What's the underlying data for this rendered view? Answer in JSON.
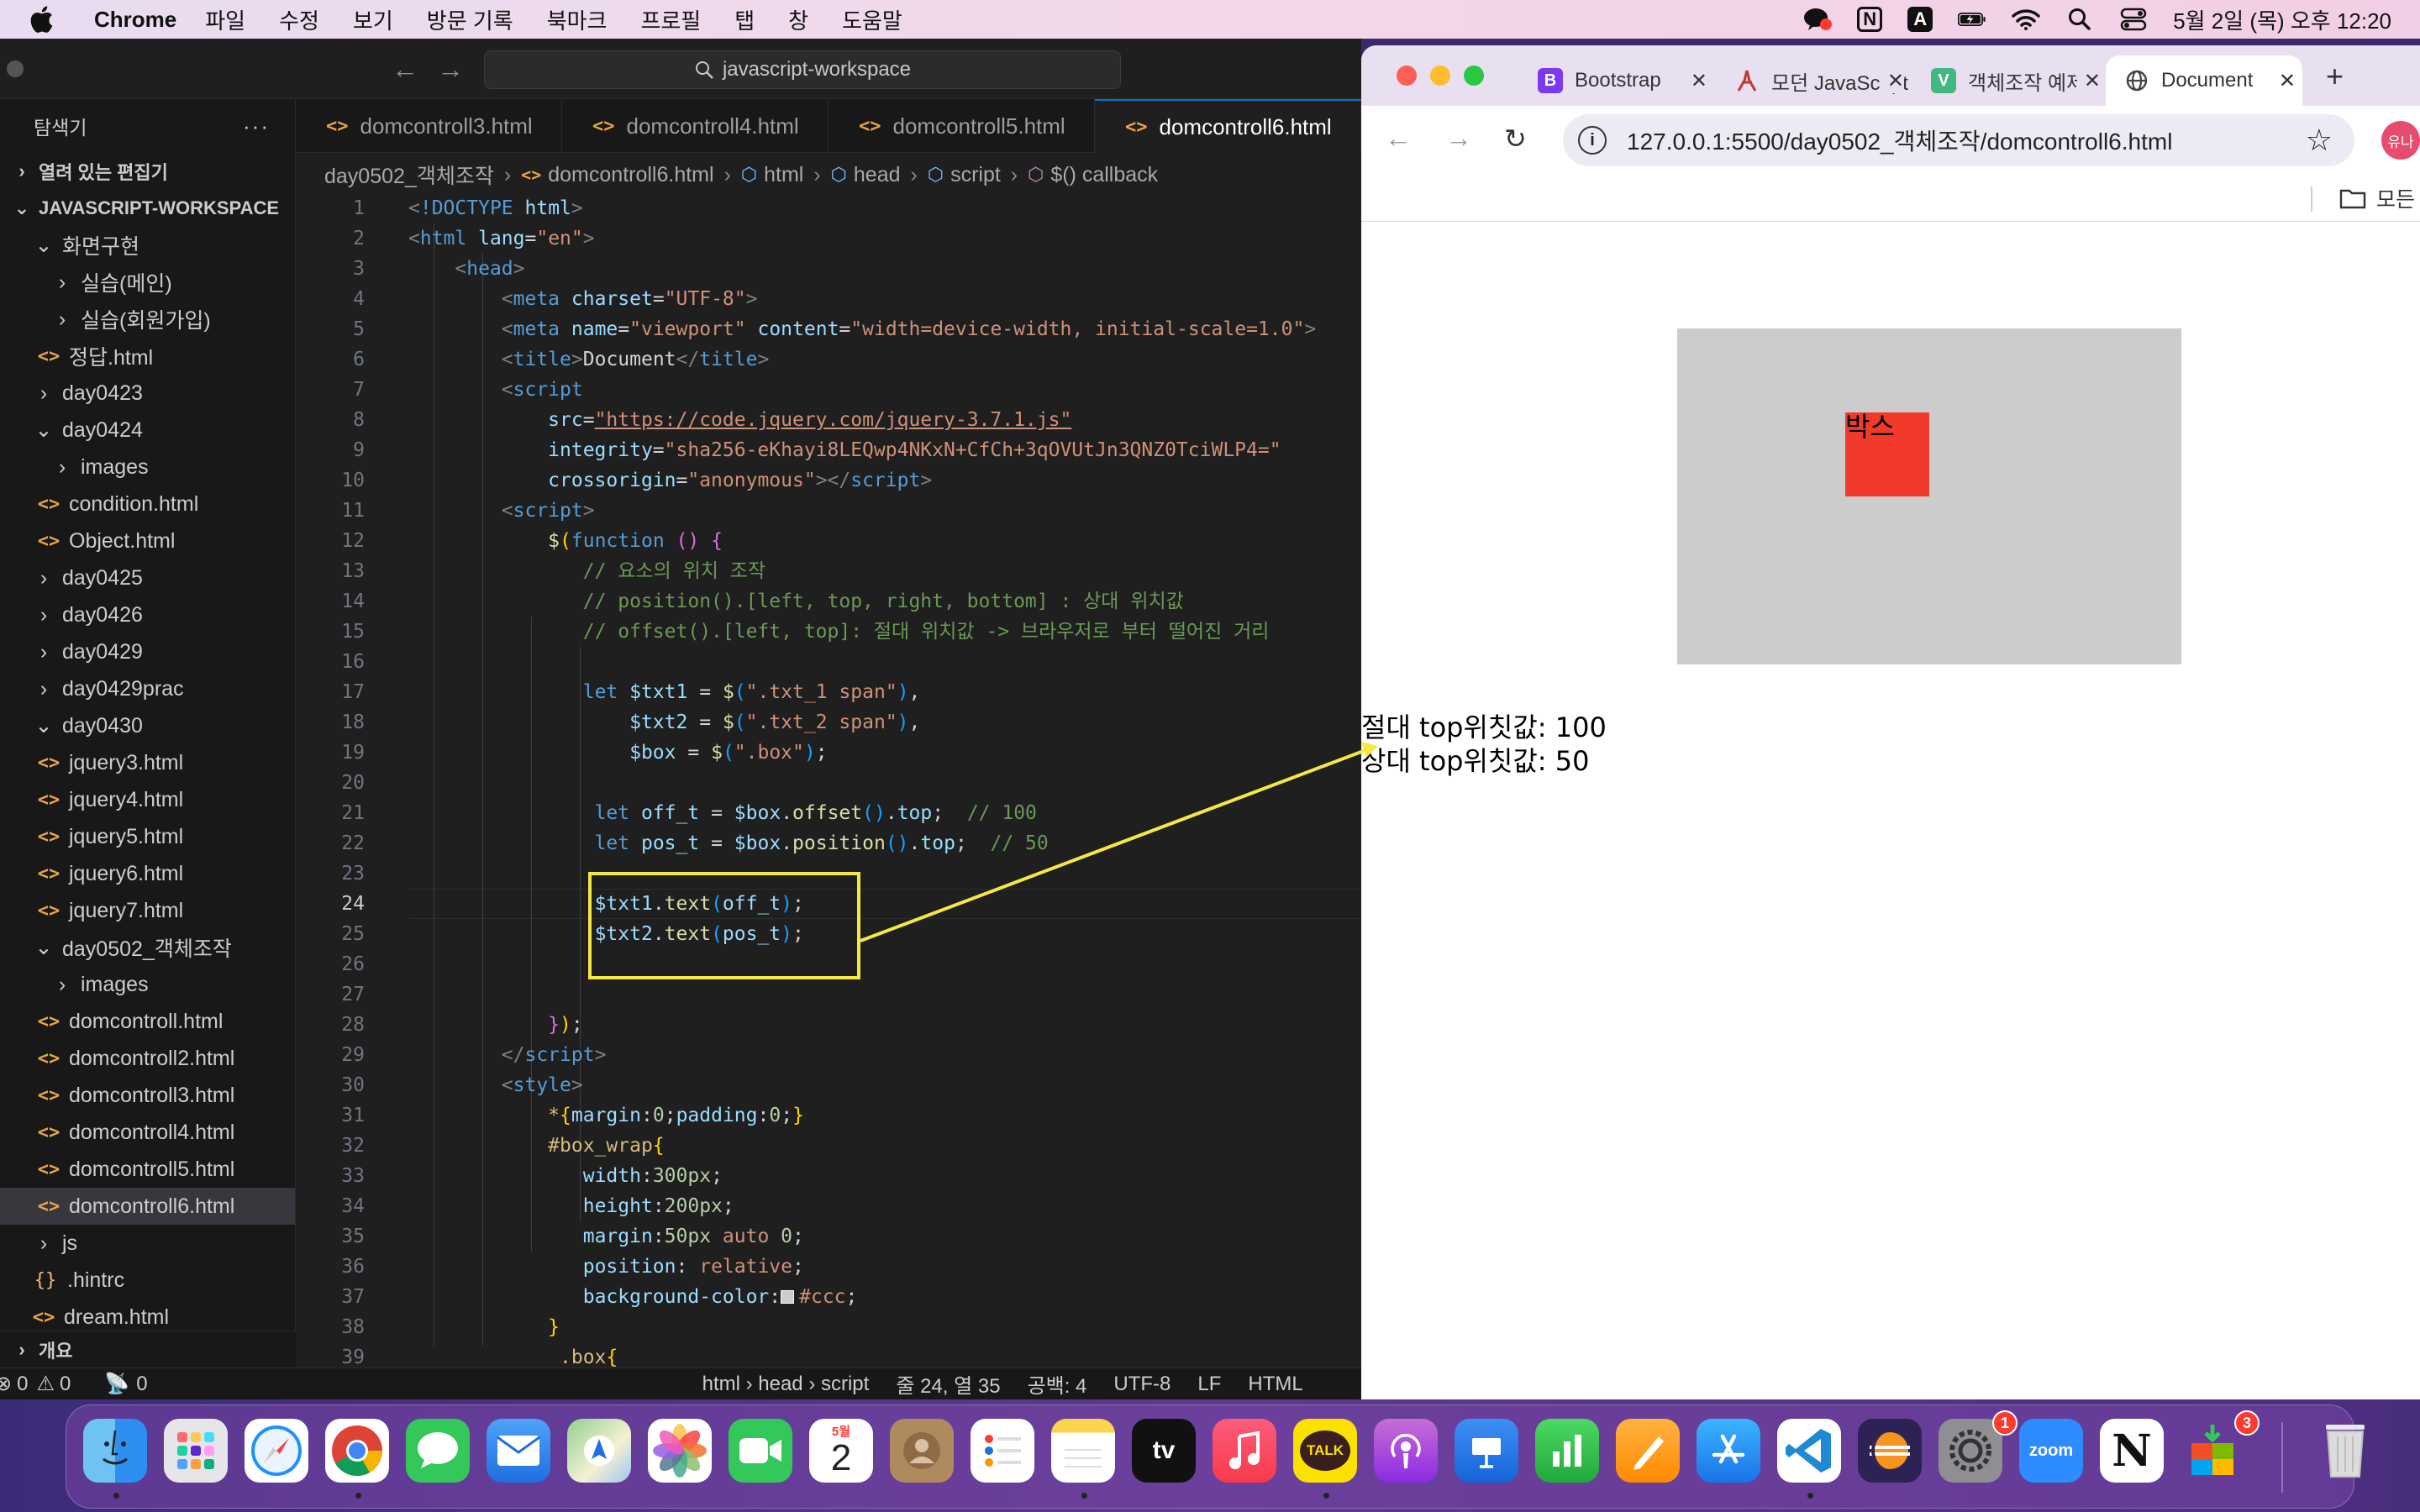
{
  "menubar": {
    "app_name": "Chrome",
    "items": [
      "파일",
      "수정",
      "보기",
      "방문 기록",
      "북마크",
      "프로필",
      "탭",
      "창",
      "도움말"
    ],
    "status_icons": [
      "kakaotalk-icon",
      "notion-icon",
      "input-method-icon",
      "battery-icon",
      "wifi-icon",
      "spotlight-icon",
      "control-center-icon"
    ],
    "notion_letter": "N",
    "input_letter": "A",
    "clock": "5월 2일 (목) 오후 12:20"
  },
  "vscode": {
    "search": "javascript-workspace",
    "explorer_title": "탐색기",
    "explorer_more": "···",
    "open_editors": "열려 있는 편집기",
    "workspace": "JAVASCRIPT-WORKSPACE",
    "tree": [
      {
        "label": "화면구현",
        "kind": "folder-open",
        "depth": 1
      },
      {
        "label": "실습(메인)",
        "kind": "folder",
        "depth": 2
      },
      {
        "label": "실습(회원가입)",
        "kind": "folder",
        "depth": 2
      },
      {
        "label": "정답.html",
        "kind": "html",
        "depth": 2
      },
      {
        "label": "day0423",
        "kind": "folder",
        "depth": 1
      },
      {
        "label": "day0424",
        "kind": "folder-open",
        "depth": 1
      },
      {
        "label": "images",
        "kind": "folder",
        "depth": 2
      },
      {
        "label": "condition.html",
        "kind": "html",
        "depth": 2
      },
      {
        "label": "Object.html",
        "kind": "html",
        "depth": 2
      },
      {
        "label": "day0425",
        "kind": "folder",
        "depth": 1
      },
      {
        "label": "day0426",
        "kind": "folder",
        "depth": 1
      },
      {
        "label": "day0429",
        "kind": "folder",
        "depth": 1
      },
      {
        "label": "day0429prac",
        "kind": "folder",
        "depth": 1
      },
      {
        "label": "day0430",
        "kind": "folder-open",
        "depth": 1
      },
      {
        "label": "jquery3.html",
        "kind": "html",
        "depth": 2
      },
      {
        "label": "jquery4.html",
        "kind": "html",
        "depth": 2
      },
      {
        "label": "jquery5.html",
        "kind": "html",
        "depth": 2
      },
      {
        "label": "jquery6.html",
        "kind": "html",
        "depth": 2
      },
      {
        "label": "jquery7.html",
        "kind": "html",
        "depth": 2
      },
      {
        "label": "day0502_객체조작",
        "kind": "folder-open",
        "depth": 1
      },
      {
        "label": "images",
        "kind": "folder",
        "depth": 2
      },
      {
        "label": "domcontroll.html",
        "kind": "html",
        "depth": 2
      },
      {
        "label": "domcontroll2.html",
        "kind": "html",
        "depth": 2
      },
      {
        "label": "domcontroll3.html",
        "kind": "html",
        "depth": 2
      },
      {
        "label": "domcontroll4.html",
        "kind": "html",
        "depth": 2
      },
      {
        "label": "domcontroll5.html",
        "kind": "html",
        "depth": 2
      },
      {
        "label": "domcontroll6.html",
        "kind": "html",
        "depth": 2,
        "active": true
      },
      {
        "label": "js",
        "kind": "folder",
        "depth": 1
      },
      {
        "label": ".hintrc",
        "kind": "json",
        "depth": 1
      },
      {
        "label": "dream.html",
        "kind": "html",
        "depth": 1
      }
    ],
    "outline": "개요",
    "tabs": [
      "domcontroll3.html",
      "domcontroll4.html",
      "domcontroll5.html",
      "domcontroll6.html"
    ],
    "breadcrumb": [
      "day0502_객체조작",
      "domcontroll6.html",
      "html",
      "head",
      "script",
      "$() callback"
    ],
    "statusbar": {
      "errors": "0",
      "warnings": "0",
      "ports": "0",
      "path": "html › head › script",
      "position": "줄 24, 열 35",
      "spaces": "공백: 4",
      "encoding": "UTF-8",
      "eol": "LF",
      "language": "HTML"
    }
  },
  "chrome": {
    "tabs": [
      {
        "title": "Bootstrap",
        "favicon": "B",
        "color": "#7c3aed"
      },
      {
        "title": "모던 JavaScript",
        "favicon": "modern-js-icon",
        "color": "#e8e0f1"
      },
      {
        "title": "객체조작 예제",
        "favicon": "V",
        "color": "#42b883"
      },
      {
        "title": "Document",
        "favicon": "globe-icon",
        "color": "#ffffff",
        "active": true
      }
    ],
    "url": "127.0.0.1:5500/day0502_객체조작/domcontroll6.html",
    "profile": "유나",
    "bookmarks_label": "모든",
    "page": {
      "box_label": "박스",
      "abs_top_text": "절대 top위칫값: 100",
      "rel_top_text": "상대 top위칫값: 50"
    }
  },
  "dock": {
    "apps": [
      {
        "name": "finder-icon"
      },
      {
        "name": "launchpad-icon"
      },
      {
        "name": "safari-icon"
      },
      {
        "name": "chrome-icon"
      },
      {
        "name": "messages-icon"
      },
      {
        "name": "mail-icon"
      },
      {
        "name": "maps-icon"
      },
      {
        "name": "photos-icon"
      },
      {
        "name": "facetime-icon"
      },
      {
        "name": "calendar-icon"
      },
      {
        "name": "contacts-icon"
      },
      {
        "name": "reminders-icon"
      },
      {
        "name": "notes-icon"
      },
      {
        "name": "appletv-icon"
      },
      {
        "name": "music-icon"
      },
      {
        "name": "kakaotalk-icon"
      },
      {
        "name": "podcasts-icon"
      },
      {
        "name": "keynote-icon"
      },
      {
        "name": "numbers-icon"
      },
      {
        "name": "pages-icon"
      },
      {
        "name": "appstore-icon"
      },
      {
        "name": "vscode-icon"
      },
      {
        "name": "eclipse-icon"
      },
      {
        "name": "system-settings-icon"
      },
      {
        "name": "zoom-icon"
      },
      {
        "name": "notion-icon"
      },
      {
        "name": "installer-icon"
      },
      {
        "name": "trash-icon"
      }
    ],
    "calendar_month": "5월",
    "calendar_day": "2",
    "tv_label": "tv",
    "talk_label": "TALK",
    "zoom_label": "zoom",
    "notion_label": "N",
    "settings_badge": "1",
    "installer_badge": "3"
  }
}
